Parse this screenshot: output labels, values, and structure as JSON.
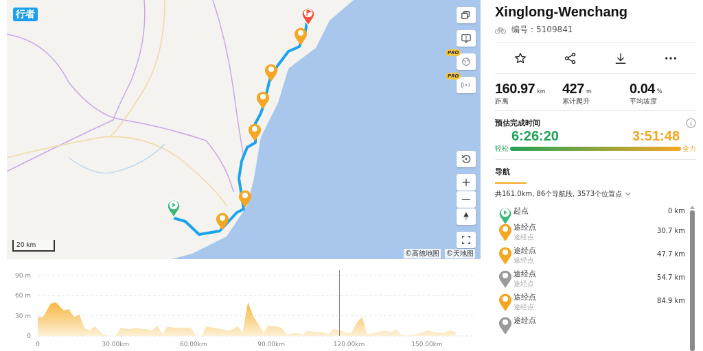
{
  "map": {
    "logo": "行者",
    "scale": "20 km",
    "attribution": [
      "©高德地图",
      "©天地图"
    ],
    "pins": [
      {
        "kind": "start"
      },
      {
        "kind": "waypoint"
      },
      {
        "kind": "waypoint"
      },
      {
        "kind": "waypoint"
      },
      {
        "kind": "waypoint"
      },
      {
        "kind": "waypoint"
      },
      {
        "kind": "waypoint"
      },
      {
        "kind": "end"
      }
    ],
    "controls": [
      {
        "kind": "layers"
      },
      {
        "kind": "feedback"
      },
      {
        "kind": "globe",
        "badge": "PRO"
      },
      {
        "kind": "signal",
        "badge": "PRO"
      },
      {
        "kind": "reset"
      },
      {
        "kind": "zoom-in"
      },
      {
        "kind": "zoom-out"
      },
      {
        "kind": "compass"
      },
      {
        "kind": "fullscreen"
      }
    ]
  },
  "elevation": {
    "chart_data": {
      "type": "area",
      "xlim": [
        0,
        168
      ],
      "ylim": [
        0,
        90
      ],
      "x": [
        0,
        2,
        5,
        7,
        10,
        12,
        14,
        16,
        18,
        20,
        22,
        25,
        28,
        30,
        32,
        35,
        38,
        40,
        42,
        44,
        46,
        48,
        50,
        53,
        56,
        59,
        61,
        63,
        65,
        68,
        71,
        74,
        77,
        79,
        81,
        83,
        85,
        87,
        89,
        92,
        94,
        96,
        98,
        100,
        102,
        104,
        107,
        110,
        112,
        114,
        117,
        119,
        121,
        123,
        125,
        127,
        129,
        131,
        134,
        136,
        138,
        140,
        142,
        145,
        148,
        150,
        153,
        156,
        159,
        161
      ],
      "values": [
        28,
        28,
        48,
        50,
        38,
        40,
        28,
        32,
        12,
        8,
        14,
        3,
        0,
        0,
        12,
        10,
        12,
        10,
        10,
        8,
        15,
        3,
        14,
        12,
        12,
        12,
        0,
        0,
        14,
        12,
        10,
        8,
        14,
        6,
        50,
        30,
        18,
        5,
        15,
        14,
        12,
        2,
        4,
        4,
        2,
        8,
        6,
        6,
        3,
        10,
        8,
        4,
        6,
        20,
        28,
        2,
        4,
        6,
        8,
        5,
        10,
        2,
        0,
        2,
        5,
        8,
        6,
        4,
        8,
        6
      ],
      "yticks": [
        {
          "value": 0,
          "label": "0"
        },
        {
          "value": 30,
          "label": "30 m"
        },
        {
          "value": 60,
          "label": "60 m"
        },
        {
          "value": 90,
          "label": "90 m"
        }
      ],
      "xticks": [
        {
          "value": 0,
          "label": "0"
        },
        {
          "value": 30,
          "label": "30.00km"
        },
        {
          "value": 60,
          "label": "60.00km"
        },
        {
          "value": 90,
          "label": "90.00km"
        },
        {
          "value": 120,
          "label": "120.00km"
        },
        {
          "value": 150,
          "label": "150.00km"
        }
      ]
    }
  },
  "route": {
    "title": "Xinglong-Wenchang",
    "number": "编号：5109841",
    "actions": [
      {
        "kind": "star"
      },
      {
        "kind": "share"
      },
      {
        "kind": "download"
      },
      {
        "kind": "more"
      }
    ],
    "stats": [
      {
        "value": "160.97",
        "unit": "km",
        "label": "距离"
      },
      {
        "value": "427",
        "unit": "m",
        "label": "累计爬升"
      },
      {
        "value": "0.04",
        "unit": "%",
        "label": "平均坡度"
      }
    ],
    "estimate": {
      "title": "预估完成时间",
      "easy_time": "6:26:20",
      "hard_time": "3:51:48",
      "easy_label": "轻松",
      "hard_label": "全力"
    },
    "nav": {
      "tab": "导航",
      "selected": true,
      "summary": "共161.0km, 86个导航段, 3573个位置点",
      "waypoints": [
        {
          "kind": "start",
          "name": "起点",
          "distance": "0 km"
        },
        {
          "kind": "waypoint",
          "name": "途经点",
          "sub": "途经点",
          "distance": "30.7 km",
          "color": "#f5a623"
        },
        {
          "kind": "waypoint",
          "name": "途经点",
          "sub": "途经点",
          "distance": "47.7 km",
          "color": "#f5a623"
        },
        {
          "kind": "waypoint",
          "name": "途经点",
          "sub": "途经点",
          "distance": "54.7 km",
          "color": "#9b9b9b"
        },
        {
          "kind": "waypoint",
          "name": "途经点",
          "sub": "途经点",
          "distance": "84.9 km",
          "color": "#f5a623"
        },
        {
          "kind": "waypoint",
          "name": "途经点",
          "color": "#9b9b9b"
        }
      ]
    }
  }
}
